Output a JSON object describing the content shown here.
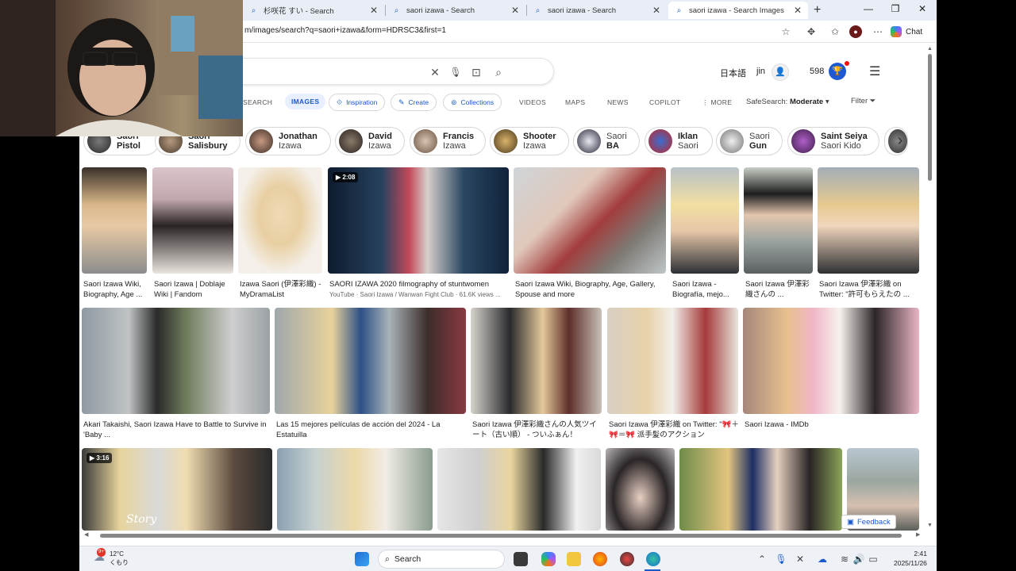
{
  "tabs": [
    {
      "label": "杉咲花 すい - Search",
      "active": false
    },
    {
      "label": "saori izawa - Search",
      "active": false
    },
    {
      "label": "saori izawa - Search",
      "active": false
    },
    {
      "label": "saori izawa - Search Images",
      "active": true
    }
  ],
  "window": {
    "new_tab": "+",
    "minimize": "—",
    "maximize": "❐",
    "close": "✕"
  },
  "address_bar": {
    "url": "m/images/search?q=saori+izawa&form=HDRSC3&first=1",
    "chat_label": "Chat"
  },
  "header": {
    "language": "日本語",
    "user": "jin",
    "points": "598"
  },
  "nav": {
    "search": "SEARCH",
    "images": "IMAGES",
    "inspiration": "Inspiration",
    "create": "Create",
    "collections": "Collections",
    "videos": "VIDEOS",
    "maps": "MAPS",
    "news": "NEWS",
    "copilot": "COPILOT",
    "more": "MORE",
    "safesearch_label": "SafeSearch:",
    "safesearch_value": "Moderate",
    "filter": "Filter"
  },
  "chips": [
    {
      "l1": "Saori",
      "l2": "Pistol",
      "bold": 2
    },
    {
      "l1": "Saori",
      "l2": "Salisbury",
      "bold": 2
    },
    {
      "l1": "Jonathan",
      "l2": "Izawa",
      "bold": 1
    },
    {
      "l1": "David",
      "l2": "Izawa",
      "bold": 1
    },
    {
      "l1": "Francis",
      "l2": "Izawa",
      "bold": 1
    },
    {
      "l1": "Shooter",
      "l2": "Izawa",
      "bold": 1
    },
    {
      "l1": "Saori",
      "l2": "BA",
      "bold": 2
    },
    {
      "l1": "Iklan",
      "l2": "Saori",
      "bold": 1
    },
    {
      "l1": "Saori",
      "l2": "Gun",
      "bold": 2
    },
    {
      "l1": "Saint Seiya",
      "l2": "Saori Kido",
      "bold": 1
    }
  ],
  "results": {
    "row1": [
      {
        "caption": "Saori Izawa Wiki, Biography, Age ..."
      },
      {
        "caption": "Saori Izawa | Doblaje Wiki | Fandom"
      },
      {
        "caption": "Izawa Saori (伊澤彩織) - MyDramaList"
      },
      {
        "caption": "SAORI IZAWA 2020 filmography of stuntwomen",
        "sub": "YouTube · Saori Izawa / Wanwan Fight Club · 61.6K views ...",
        "duration": "2:08"
      },
      {
        "caption": "Saori Izawa Wiki, Biography, Age, Gallery, Spouse and more"
      },
      {
        "caption": "Saori Izawa - Biografía, mejo..."
      },
      {
        "caption": "Saori Izawa 伊澤彩織さんの ..."
      },
      {
        "caption": "Saori Izawa 伊澤彩織 on Twitter: \"許可もらえたの ..."
      }
    ],
    "row2": [
      {
        "caption": "Akari Takaishi, Saori Izawa Have to Battle to Survive in 'Baby ..."
      },
      {
        "caption": "Las 15 mejores películas de acción del 2024 - La Estatuilla"
      },
      {
        "caption": "Saori Izawa 伊澤彩織さんの人気ツイート（古い順） - ついふぁん！"
      },
      {
        "caption": "Saori Izawa 伊澤彩織 on Twitter: \"🎀＋🎀＝🎀 派手髪のアクション"
      },
      {
        "caption": "Saori Izawa - IMDb"
      }
    ],
    "row3": [
      {
        "duration": "3:16",
        "overlay": "Story"
      },
      {},
      {},
      {},
      {},
      {}
    ]
  },
  "feedback": "Feedback",
  "taskbar": {
    "search": "Search",
    "temp": "12°C",
    "weather": "くもり",
    "time": "2:41",
    "date": "2025/11/26",
    "badge": "9+"
  },
  "colors": {
    "accent": "#1a59c9",
    "tab_strip": "#e9eef6",
    "taskbar": "#eef1f6"
  }
}
